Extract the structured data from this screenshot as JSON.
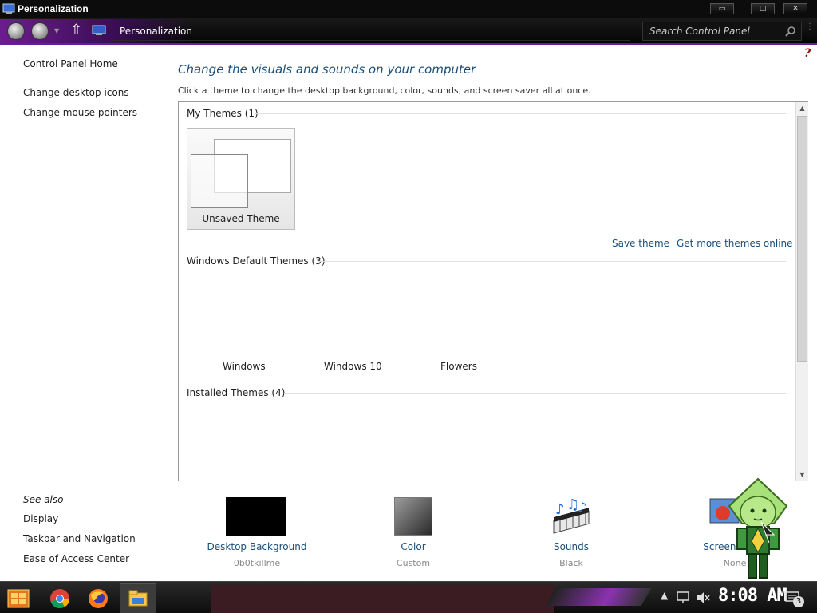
{
  "window": {
    "title": "Personalization",
    "min_label": "▭",
    "max_label": "□",
    "close_label": "✕"
  },
  "addressbar": {
    "breadcrumb": "Personalization",
    "search_placeholder": "Search Control Panel"
  },
  "leftnav": {
    "home": "Control Panel Home",
    "desktop_icons": "Change desktop icons",
    "mouse_pointers": "Change mouse pointers",
    "see_also": "See also",
    "display": "Display",
    "taskbar": "Taskbar and Navigation",
    "ease": "Ease of Access Center"
  },
  "main": {
    "heading": "Change the visuals and sounds on your computer",
    "subtext": "Click a theme to change the desktop background, color, sounds, and screen saver all at once.",
    "help": "?",
    "my_themes": {
      "title": "My Themes (1)",
      "tiles": [
        {
          "label": "Unsaved Theme"
        }
      ]
    },
    "save_theme": "Save theme",
    "get_more": "Get more themes online",
    "default_themes": {
      "title": "Windows Default Themes (3)",
      "tiles": [
        {
          "label": "Windows"
        },
        {
          "label": "Windows 10"
        },
        {
          "label": "Flowers"
        }
      ]
    },
    "installed_themes": {
      "title": "Installed Themes (4)"
    }
  },
  "settings": [
    {
      "label": "Desktop Background",
      "value": "0b0tkillme"
    },
    {
      "label": "Color",
      "value": "Custom"
    },
    {
      "label": "Sounds",
      "value": "Black"
    },
    {
      "label": "Screen Saver",
      "value": "None"
    }
  ],
  "taskbar": {
    "clock": "8:08 AM",
    "notification_count": "3",
    "icons": [
      "start-icon",
      "chrome-icon",
      "firefox-icon",
      "file-explorer-icon"
    ]
  },
  "colors": {
    "accent": "#1a4e79",
    "titlebar": "#0c0c0c",
    "purple": "#6b1d8f",
    "help": "#a01010"
  }
}
